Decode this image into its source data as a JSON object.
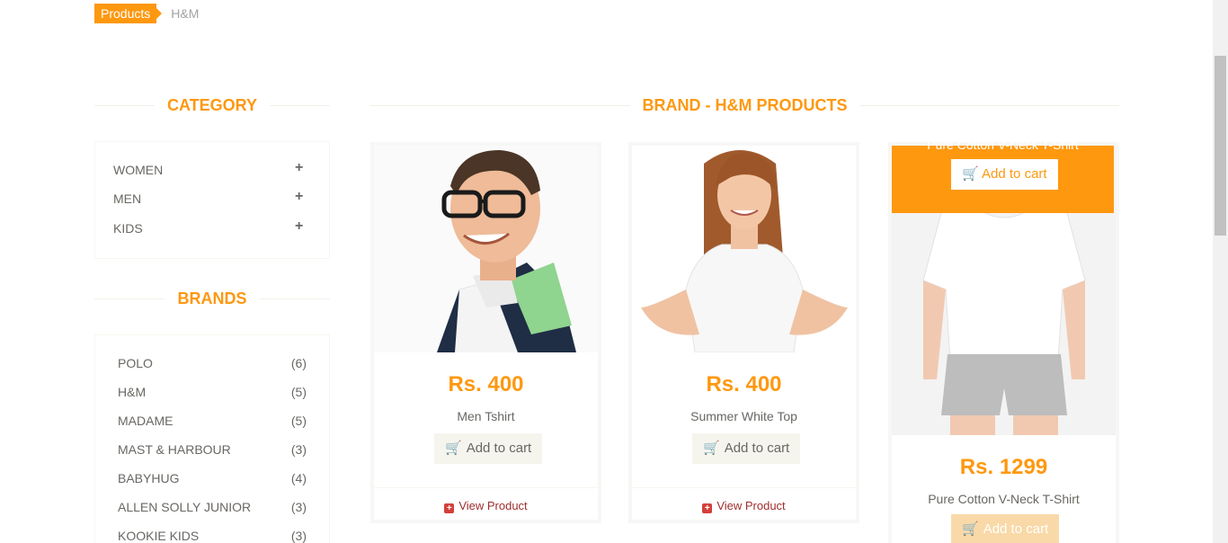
{
  "breadcrumb": {
    "active": "Products",
    "current": "H&M"
  },
  "category": {
    "title": "CATEGORY",
    "items": [
      {
        "label": "WOMEN",
        "icon": "+"
      },
      {
        "label": "MEN",
        "icon": "+"
      },
      {
        "label": "KIDS",
        "icon": "+"
      }
    ]
  },
  "brands": {
    "title": "BRANDS",
    "items": [
      {
        "name": "POLO",
        "count": "(6)"
      },
      {
        "name": "H&M",
        "count": "(5)"
      },
      {
        "name": "MADAME",
        "count": "(5)"
      },
      {
        "name": "MAST & HARBOUR",
        "count": "(3)"
      },
      {
        "name": "BABYHUG",
        "count": "(4)"
      },
      {
        "name": "ALLEN SOLLY JUNIOR",
        "count": "(3)"
      },
      {
        "name": "KOOKIE KIDS",
        "count": "(3)"
      }
    ]
  },
  "main": {
    "title": "BRAND - H&M PRODUCTS"
  },
  "products": [
    {
      "price": "Rs. 400",
      "name": "Men Tshirt",
      "cart_label": "Add to cart",
      "view_label": "View Product"
    },
    {
      "price": "Rs. 400",
      "name": "Summer White Top",
      "cart_label": "Add to cart",
      "view_label": "View Product"
    },
    {
      "price": "Rs. 1299",
      "name": "Pure Cotton V-Neck T-Shirt",
      "cart_label": "Add to cart",
      "overlay_text": "Pure Cotton V-Neck T-Shirt",
      "overlay_cart_label": "Add to cart"
    }
  ],
  "colors": {
    "accent": "#FE980F",
    "text": "#696763",
    "link": "#a02e2e"
  },
  "icons": {
    "cart": "shopping-cart-icon",
    "plus": "plus-icon",
    "view": "plus-square-icon"
  }
}
